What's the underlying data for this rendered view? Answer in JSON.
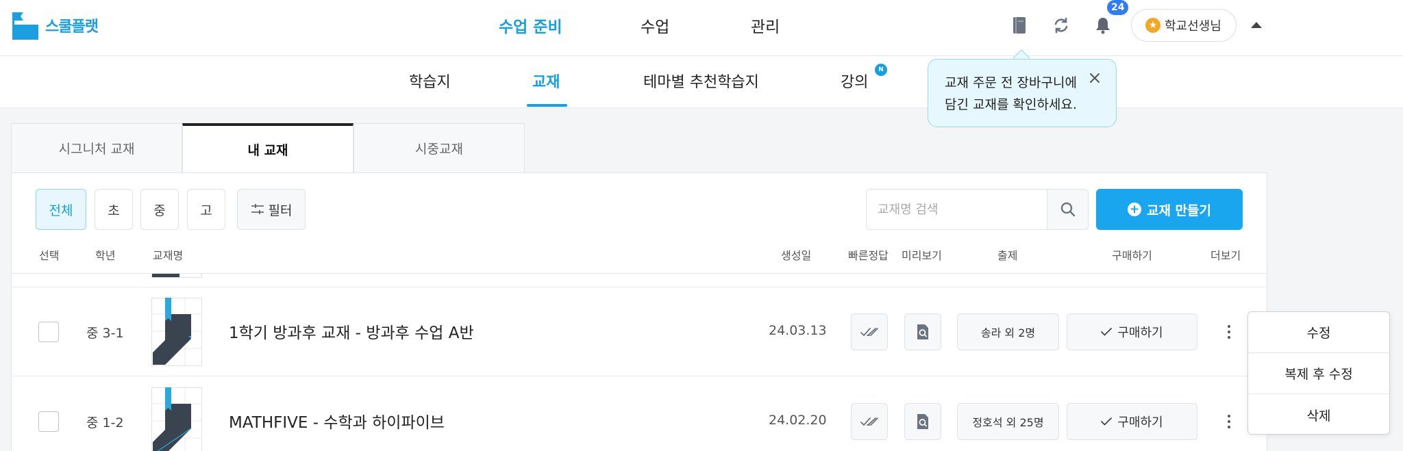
{
  "app": {
    "logo_text": "스쿨플랫"
  },
  "main_nav": [
    {
      "label": "수업 준비",
      "active": true
    },
    {
      "label": "수업",
      "active": false
    },
    {
      "label": "관리",
      "active": false
    }
  ],
  "header": {
    "notification_count": "24",
    "user_name": "학교선생님"
  },
  "sub_nav": [
    {
      "label": "학습지",
      "active": false
    },
    {
      "label": "교재",
      "active": true
    },
    {
      "label": "테마별 추천학습지",
      "active": false
    },
    {
      "label": "강의",
      "active": false,
      "badge": "N"
    }
  ],
  "tooltip": {
    "line1": "교재 주문 전 장바구니에",
    "line2": "담긴 교재를 확인하세요."
  },
  "tabs": [
    {
      "label": "시그니처 교재",
      "active": false
    },
    {
      "label": "내 교재",
      "active": true
    },
    {
      "label": "시중교재",
      "active": false
    }
  ],
  "filters": {
    "chips": [
      {
        "label": "전체",
        "active": true
      },
      {
        "label": "초",
        "active": false
      },
      {
        "label": "중",
        "active": false
      },
      {
        "label": "고",
        "active": false
      }
    ],
    "filter_label": "필터",
    "search_placeholder": "교재명 검색",
    "create_label": "교재 만들기"
  },
  "table": {
    "headers": {
      "select": "선택",
      "grade": "학년",
      "name": "교재명",
      "created": "생성일",
      "quick_answer": "빠른정답",
      "preview": "미리보기",
      "assign": "출제",
      "purchase": "구매하기",
      "more": "더보기"
    },
    "rows": [
      {
        "grade": "중 3-1",
        "title": "1학기 방과후 교재 - 방과후 수업 A반",
        "date": "24.03.13",
        "assign": "송라 외 2명",
        "buy": "구매하기"
      },
      {
        "grade": "중 1-2",
        "title": "MATHFIVE - 수학과 하이파이브",
        "date": "24.02.20",
        "assign": "정호석 외 25명",
        "buy": "구매하기"
      }
    ]
  },
  "more_menu": [
    "수정",
    "복제 후 수정",
    "삭제"
  ],
  "colors": {
    "accent": "#16a0e4",
    "primary_button": "#1aa6ee",
    "book_cover": "#3a4450",
    "book_ribbon": "#2aa9dc"
  }
}
